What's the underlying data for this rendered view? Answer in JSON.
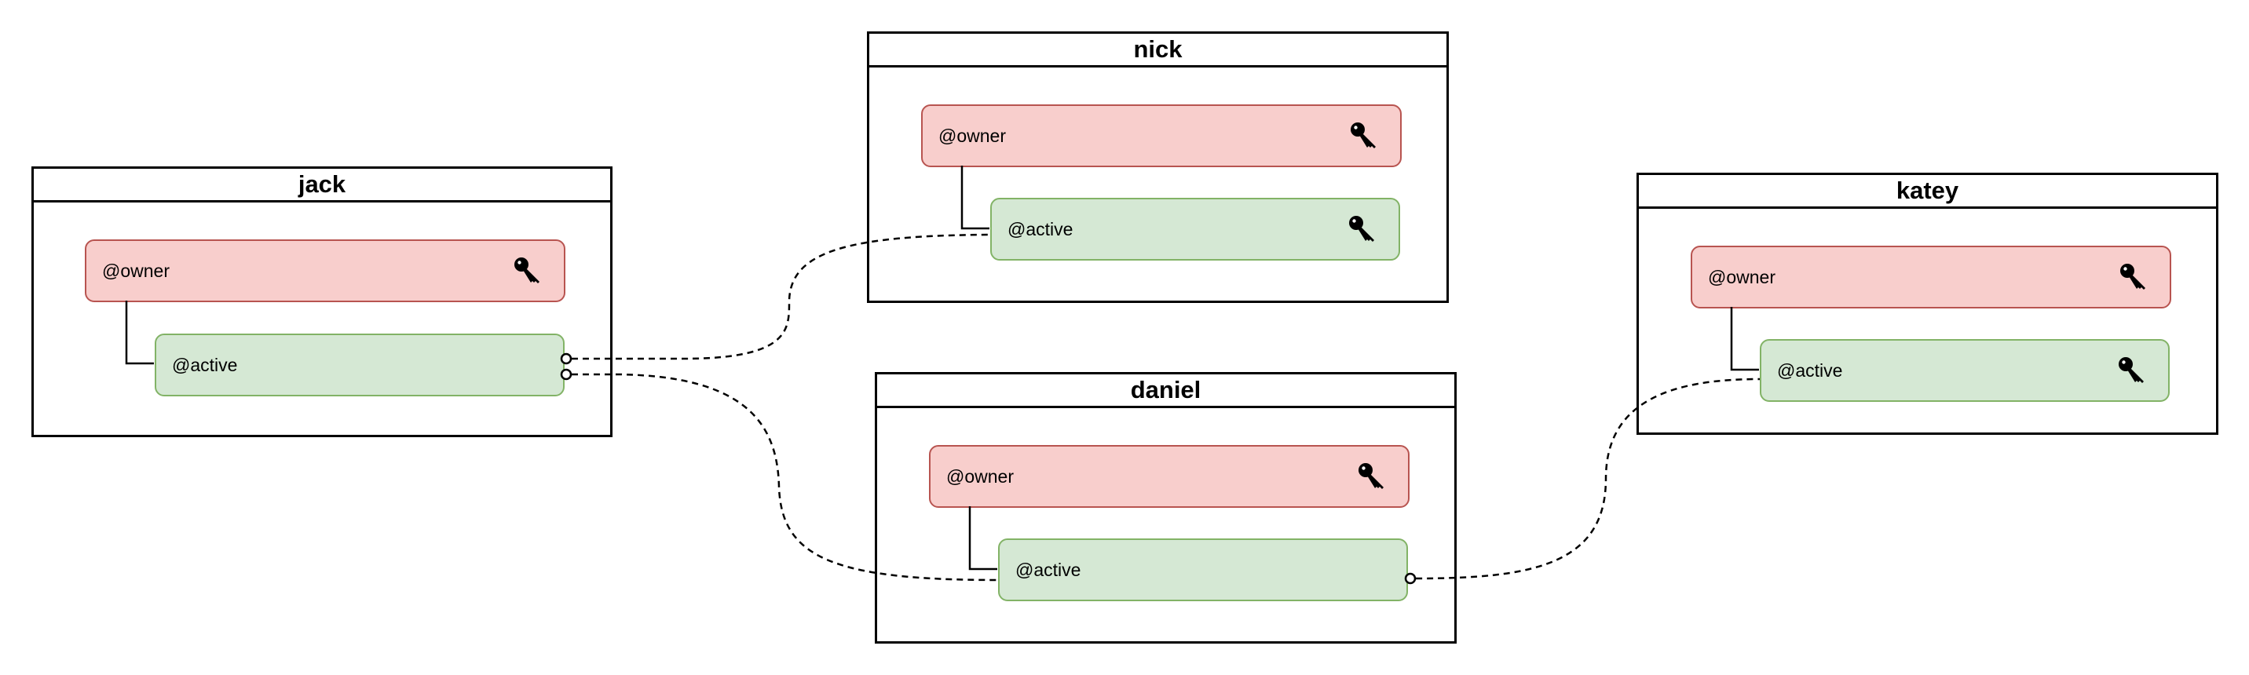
{
  "diagram": {
    "colors": {
      "owner_fill": "#f8cecc",
      "owner_stroke": "#b85450",
      "active_fill": "#d5e8d4",
      "active_stroke": "#82b366",
      "line": "#000000"
    },
    "entities": [
      {
        "id": "jack",
        "title": "jack",
        "fields": [
          {
            "label": "@owner",
            "type": "owner",
            "key_icon": true
          },
          {
            "label": "@active",
            "type": "active",
            "key_icon": false
          }
        ]
      },
      {
        "id": "nick",
        "title": "nick",
        "fields": [
          {
            "label": "@owner",
            "type": "owner",
            "key_icon": true
          },
          {
            "label": "@active",
            "type": "active",
            "key_icon": true
          }
        ]
      },
      {
        "id": "daniel",
        "title": "daniel",
        "fields": [
          {
            "label": "@owner",
            "type": "owner",
            "key_icon": true
          },
          {
            "label": "@active",
            "type": "active",
            "key_icon": false
          }
        ]
      },
      {
        "id": "katey",
        "title": "katey",
        "fields": [
          {
            "label": "@owner",
            "type": "owner",
            "key_icon": true
          },
          {
            "label": "@active",
            "type": "active",
            "key_icon": true
          }
        ]
      }
    ],
    "links": [
      {
        "from": "jack.@active",
        "to": "nick.@active",
        "style": "dashed",
        "start_marker": "circle"
      },
      {
        "from": "jack.@active",
        "to": "daniel.@active",
        "style": "dashed",
        "start_marker": "circle"
      },
      {
        "from": "daniel.@active",
        "to": "katey.@active",
        "style": "dashed",
        "start_marker": "circle"
      }
    ]
  }
}
